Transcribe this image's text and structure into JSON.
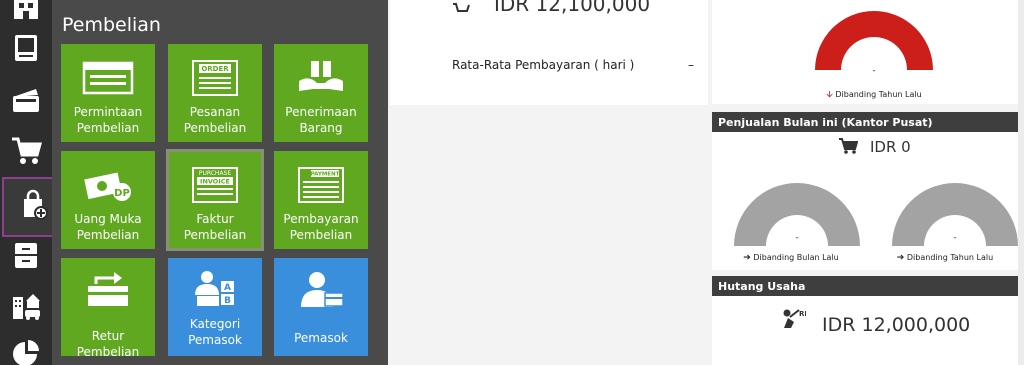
{
  "rail": {
    "items": [
      {
        "name": "rail-item-home",
        "icon": "building-icon"
      },
      {
        "name": "rail-item-book",
        "icon": "book-icon"
      },
      {
        "name": "rail-item-wallet",
        "icon": "wallet-icon"
      },
      {
        "name": "rail-item-cart",
        "icon": "cart-icon"
      },
      {
        "name": "rail-item-purchase",
        "icon": "shopping-bag-plus-icon",
        "active": true
      },
      {
        "name": "rail-item-archive",
        "icon": "archive-icon"
      },
      {
        "name": "rail-item-assets",
        "icon": "assets-icon"
      },
      {
        "name": "rail-item-reports",
        "icon": "pie-chart-icon"
      }
    ]
  },
  "panel": {
    "title": "Pembelian",
    "tiles": [
      {
        "line1": "Permintaan",
        "line2": "Pembelian",
        "icon": "request-form-icon",
        "color": "#5fa820"
      },
      {
        "line1": "Pesanan",
        "line2": "Pembelian",
        "icon": "order-form-icon",
        "color": "#5fa820",
        "badge": "ORDER"
      },
      {
        "line1": "Penerimaan",
        "line2": "Barang",
        "icon": "receive-goods-icon",
        "color": "#5fa820"
      },
      {
        "line1": "Uang Muka",
        "line2": "Pembelian",
        "icon": "down-payment-icon",
        "color": "#5fa820",
        "badge": "DP"
      },
      {
        "line1": "Faktur",
        "line2": "Pembelian",
        "icon": "purchase-invoice-icon",
        "color": "#5fa820",
        "badge1": "PURCHASE",
        "badge2": "INVOICE",
        "selected": true
      },
      {
        "line1": "Pembayaran",
        "line2": "Pembelian",
        "icon": "payment-form-icon",
        "color": "#5fa820",
        "badge": "PAYMENT"
      },
      {
        "line1": "Retur Pembelian",
        "line2": "",
        "icon": "return-icon",
        "color": "#5fa820"
      },
      {
        "line1": "Kategori",
        "line2": "Pemasok",
        "icon": "supplier-category-icon",
        "color": "#3a8fdc",
        "badgeA": "A",
        "badgeB": "B"
      },
      {
        "line1": "Pemasok",
        "line2": "",
        "icon": "supplier-icon",
        "color": "#3a8fdc"
      }
    ]
  },
  "mid": {
    "amount": "IDR 12,100,000",
    "avg_label": "Rata-Rata Pembayaran ( hari )",
    "avg_value": "–"
  },
  "right": {
    "top_gauge": {
      "value": "-",
      "caption": "Dibanding Tahun Lalu",
      "color": "#cc1f1a",
      "arrow": "down"
    },
    "sales": {
      "header": "Penjualan Bulan ini (Kantor Pusat)",
      "amount": "IDR 0",
      "gauge_left": {
        "value": "-",
        "caption": "Dibanding Bulan Lalu",
        "color": "#a3a3a3"
      },
      "gauge_right": {
        "value": "-",
        "caption": "Dibanding Tahun Lalu",
        "color": "#a3a3a3"
      }
    },
    "payable": {
      "header": "Hutang Usaha",
      "amount": "IDR 12,000,000",
      "icon_badge": "RP"
    }
  },
  "colors": {
    "rail_bg": "#2d2d2d",
    "panel_bg": "#4a4a4a",
    "tile_green": "#5fa820",
    "tile_blue": "#3a8fdc",
    "active_outline": "#8a3f8f",
    "header_bg": "#3e3e3e"
  }
}
